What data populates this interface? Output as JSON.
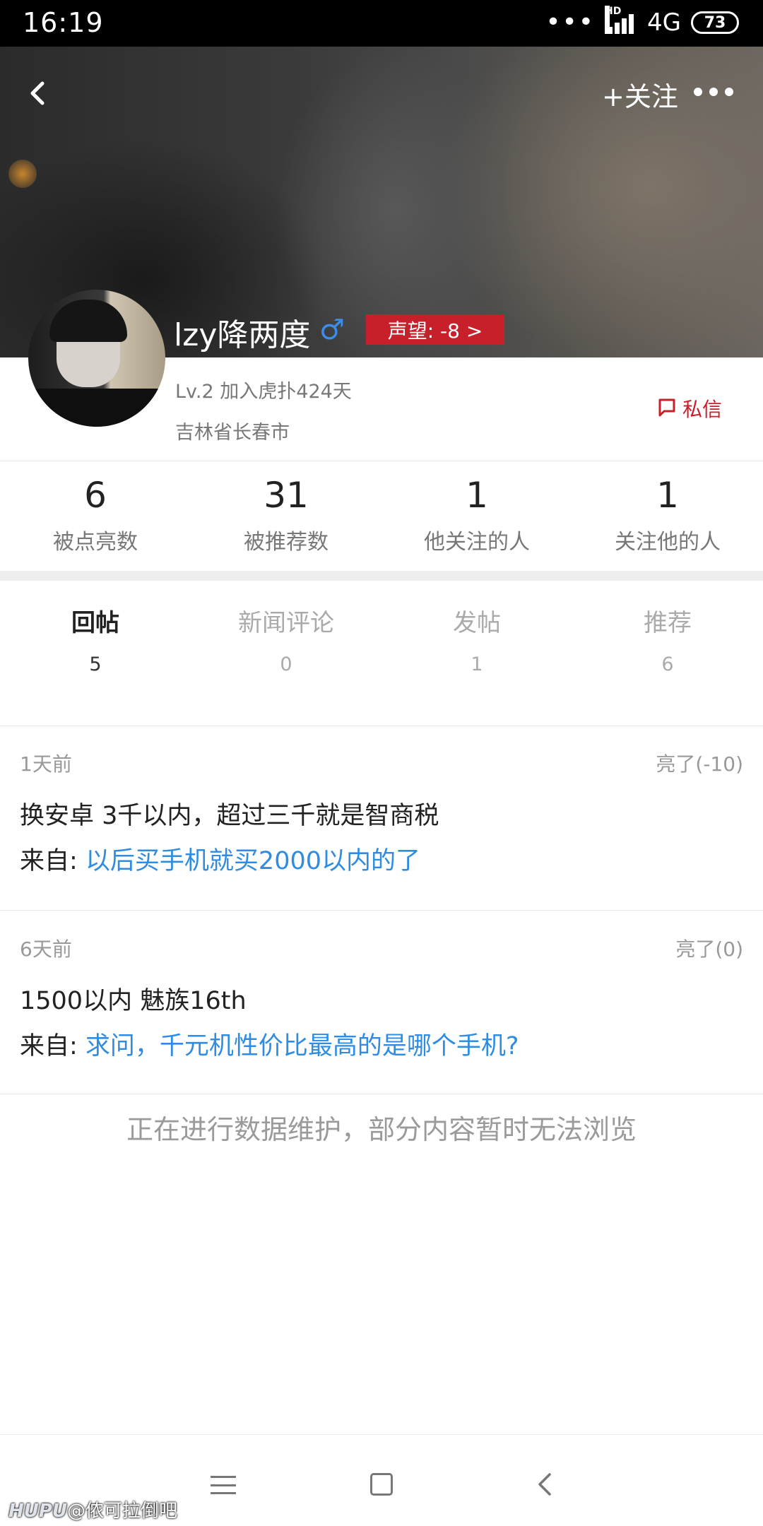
{
  "status_bar": {
    "time": "16:19",
    "dots": "•••",
    "hd": "HD",
    "network": "4G",
    "battery": "73"
  },
  "header": {
    "follow_label": "+关注"
  },
  "profile": {
    "username": "lzy降两度",
    "gender_symbol": "♂",
    "reputation": "声望: -8 >",
    "level_line": "Lv.2  加入虎扑424天",
    "location": "吉林省长春市",
    "message_label": "私信"
  },
  "stats": [
    {
      "value": "6",
      "label": "被点亮数"
    },
    {
      "value": "31",
      "label": "被推荐数"
    },
    {
      "value": "1",
      "label": "他关注的人"
    },
    {
      "value": "1",
      "label": "关注他的人"
    }
  ],
  "tabs": [
    {
      "label": "回帖",
      "count": "5",
      "active": true
    },
    {
      "label": "新闻评论",
      "count": "0",
      "active": false
    },
    {
      "label": "发帖",
      "count": "1",
      "active": false
    },
    {
      "label": "推荐",
      "count": "6",
      "active": false
    }
  ],
  "posts": [
    {
      "time": "1天前",
      "likes": "亮了(-10)",
      "text": "换安卓 3千以内，超过三千就是智商税",
      "source_prefix": "来自: ",
      "source_link": "以后买手机就买2000以内的了"
    },
    {
      "time": "6天前",
      "likes": "亮了(0)",
      "text": "1500以内 魅族16th",
      "source_prefix": "来自: ",
      "source_link": "求问，千元机性价比最高的是哪个手机?"
    }
  ],
  "notice": "正在进行数据维护，部分内容暂时无法浏览",
  "watermark": {
    "brand": "HUPU",
    "handle": "@侬可拉倒吧"
  },
  "colors": {
    "accent_red": "#c7202b",
    "link_blue": "#2f8ce0",
    "gender_blue": "#3b8de8"
  }
}
